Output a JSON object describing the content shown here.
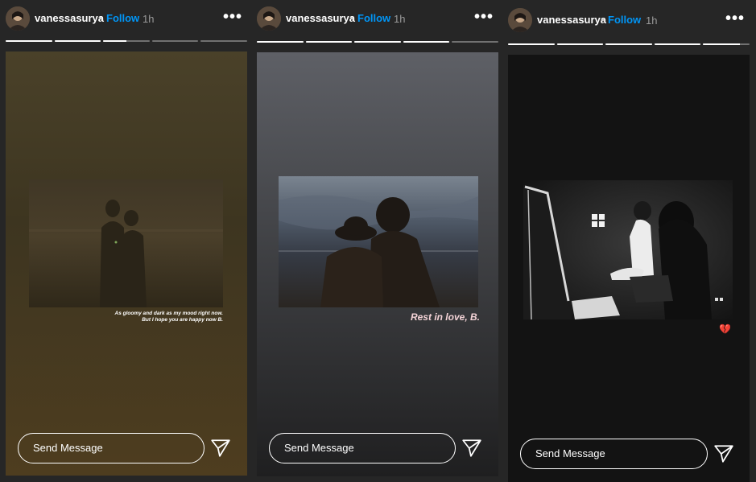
{
  "stories": [
    {
      "username": "vanessasurya",
      "separator": "•",
      "follow_label": "Follow",
      "time": "1h",
      "more": "•••",
      "progress": [
        1,
        1,
        0.5,
        0,
        0
      ],
      "caption_lines": [
        "As gloomy and dark as my mood right now.",
        "But I hope you are happy now B."
      ],
      "emoji": "",
      "send_placeholder": "Send Message",
      "colors": {
        "bg_top": "#4a4129",
        "bg_bottom": "#4e3d1f",
        "photo": "#3a3322"
      }
    },
    {
      "username": "vanessasurya",
      "separator": "•",
      "follow_label": "Follow",
      "time": "1h",
      "more": "•••",
      "progress": [
        1,
        1,
        1,
        1,
        0
      ],
      "caption_lines": [
        "Rest in love, B."
      ],
      "emoji": "",
      "send_placeholder": "Send Message",
      "colors": {
        "bg_top": "#5e6066",
        "bg_bottom": "#1f1f20",
        "photo": "#4b4d55"
      }
    },
    {
      "username": "vanessasurya",
      "separator": "•",
      "follow_label": "Follow",
      "time": "1h",
      "more": "•••",
      "progress": [
        1,
        1,
        1,
        1,
        0.8
      ],
      "caption_lines": [],
      "emoji": "💔",
      "send_placeholder": "Send Message",
      "colors": {
        "bg_top": "#131313",
        "bg_bottom": "#121212",
        "photo": "#1c1c1c"
      }
    }
  ]
}
